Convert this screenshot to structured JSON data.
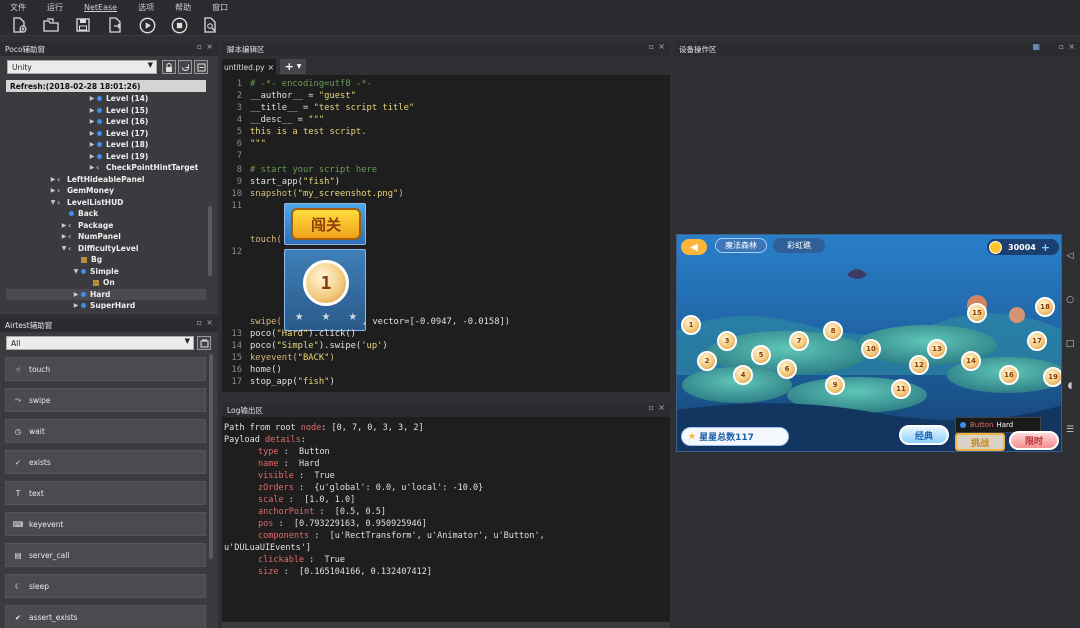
{
  "menu": [
    "文件",
    "运行",
    "NetEase",
    "选项",
    "帮助",
    "窗口"
  ],
  "toolbar": {
    "icons": [
      "new-file-icon",
      "open-folder-icon",
      "save-icon",
      "export-icon",
      "run-icon",
      "stop-icon",
      "report-icon"
    ]
  },
  "poco": {
    "title": "Poco辅助窗",
    "selector_value": "Unity",
    "refresh_label": "Refresh:(2018-02-28 18:01:26)",
    "tree": [
      {
        "label": "Level (14)",
        "indent": 88,
        "kind": "dot"
      },
      {
        "label": "Level (15)",
        "indent": 88,
        "kind": "dot"
      },
      {
        "label": "Level (16)",
        "indent": 88,
        "kind": "dot"
      },
      {
        "label": "Level (17)",
        "indent": 88,
        "kind": "dot"
      },
      {
        "label": "Level (18)",
        "indent": 88,
        "kind": "dot"
      },
      {
        "label": "Level (19)",
        "indent": 88,
        "kind": "dot"
      },
      {
        "label": "CheckPointHintTarget",
        "indent": 88,
        "kind": "chev"
      },
      {
        "label": "LeftHideablePanel",
        "indent": 49,
        "kind": "chev"
      },
      {
        "label": "GemMoney",
        "indent": 49,
        "kind": "chev"
      },
      {
        "label": "LevelListHUD",
        "indent": 49,
        "kind": "chev",
        "open": true
      },
      {
        "label": "Back",
        "indent": 60,
        "kind": "dot",
        "notw": true
      },
      {
        "label": "Package",
        "indent": 60,
        "kind": "chev"
      },
      {
        "label": "NumPanel",
        "indent": 60,
        "kind": "chev"
      },
      {
        "label": "DifficultyLevel",
        "indent": 60,
        "kind": "chev",
        "open": true
      },
      {
        "label": "Bg",
        "indent": 72,
        "kind": "img",
        "notw": true
      },
      {
        "label": "Simple",
        "indent": 72,
        "kind": "dot",
        "open": true
      },
      {
        "label": "On",
        "indent": 84,
        "kind": "img",
        "notw": true
      },
      {
        "label": "Hard",
        "indent": 72,
        "kind": "dot",
        "selected": true
      },
      {
        "label": "SuperHard",
        "indent": 72,
        "kind": "dot"
      }
    ]
  },
  "airtest": {
    "title": "Airtest辅助窗",
    "filter_value": "All",
    "buttons": [
      {
        "label": "touch",
        "icon": "hand-icon"
      },
      {
        "label": "swipe",
        "icon": "swipe-icon"
      },
      {
        "label": "wait",
        "icon": "clock-icon"
      },
      {
        "label": "exists",
        "icon": "check-icon"
      },
      {
        "label": "text",
        "icon": "text-icon"
      },
      {
        "label": "keyevent",
        "icon": "keyboard-icon"
      },
      {
        "label": "server_call",
        "icon": "server-icon"
      },
      {
        "label": "sleep",
        "icon": "moon-icon"
      },
      {
        "label": "assert_exists",
        "icon": "assert-icon"
      }
    ]
  },
  "editor": {
    "title": "脚本编辑区",
    "tab_label": "untitled.py",
    "tab_close": "×",
    "lines": {
      "l1": "# -*- encoding=utf8 -*-",
      "l2a": "__author__ = ",
      "l2b": "\"guest\"",
      "l3a": "__title__ = ",
      "l3b": "\"test script title\"",
      "l4a": "__desc__ = ",
      "l4b": "\"\"\"",
      "l5": "this is a test script.",
      "l6": "\"\"\"",
      "l8": "# start your script here",
      "l9a": "start_app(",
      "l9b": "\"fish\"",
      "l9c": ")",
      "l10a": "snapshot(",
      "l10b": "\"my_screenshot.png\"",
      "l10c": ")",
      "touch_a": "touch(",
      "touch_b": ")",
      "swipe_a": "swipe(",
      "swipe_b": ", vector=[",
      "swipe_c": "-0.0947, -0.0158",
      "swipe_d": "])",
      "l13a": "poco(",
      "l13b": "\"Hard\"",
      "l13c": ").click()",
      "l14a": "poco(",
      "l14b": "\"Simple\"",
      "l14c": ").swipe(",
      "l14d": "'up'",
      "l14e": ")",
      "l15a": "keyevent(",
      "l15b": "\"BACK\"",
      "l15c": ")",
      "l16": "home()",
      "l17a": "stop_app(",
      "l17b": "\"fish\"",
      "l17c": ")"
    },
    "line_numbers": [
      "1",
      "2",
      "3",
      "4",
      "5",
      "6",
      "7",
      "8",
      "9",
      "10",
      "11",
      "12",
      "13",
      "14",
      "15",
      "16",
      "17"
    ],
    "thumb_text_1": "闯关",
    "thumb_text_2": "1"
  },
  "log": {
    "title": "Log输出区",
    "path_a": "Path from root ",
    "path_b": "node",
    "path_c": ": [0, 7, 0, 3, 3, 2]",
    "payload_a": "Payload ",
    "payload_b": "details",
    "payload_c": ":",
    "fields": [
      {
        "k": "type",
        "v": "Button"
      },
      {
        "k": "name",
        "v": "Hard"
      },
      {
        "k": "visible",
        "v": "True"
      },
      {
        "k": "zOrders",
        "v": "{u'global': 0.0, u'local': -10.0}"
      },
      {
        "k": "scale",
        "v": "[1.0, 1.0]"
      },
      {
        "k": "anchorPoint",
        "v": "[0.5, 0.5]"
      },
      {
        "k": "pos",
        "v": "[0.793229163, 0.950925946]"
      },
      {
        "k": "components",
        "v": "[u'RectTransform', u'Animator', u'Button',"
      },
      {
        "k": "clickable",
        "v": "True"
      },
      {
        "k": "size",
        "v": "[0.165104166, 0.132407412]"
      }
    ],
    "components_cont": "u'DULuaUIEvents']"
  },
  "device": {
    "title": "设备操作区",
    "game": {
      "tab1": "魔法森林",
      "tab2": "彩虹礁",
      "coins": "30004",
      "plus": "+",
      "star_total": "星星总数117",
      "btn_classic": "经典",
      "btn_challenge": "挑战",
      "btn_timed": "限时",
      "tooltip_kind": "Button",
      "tooltip_name": "Hard",
      "levels": [
        "1",
        "2",
        "3",
        "4",
        "5",
        "6",
        "7",
        "8",
        "9",
        "10",
        "11",
        "12",
        "13",
        "14",
        "15",
        "16",
        "17",
        "18",
        "19"
      ]
    }
  },
  "colors": {
    "accent": "#3d8ef0",
    "keyword": "#d7ba7d",
    "string": "#e8d67a",
    "log_key": "#e16a6a"
  }
}
